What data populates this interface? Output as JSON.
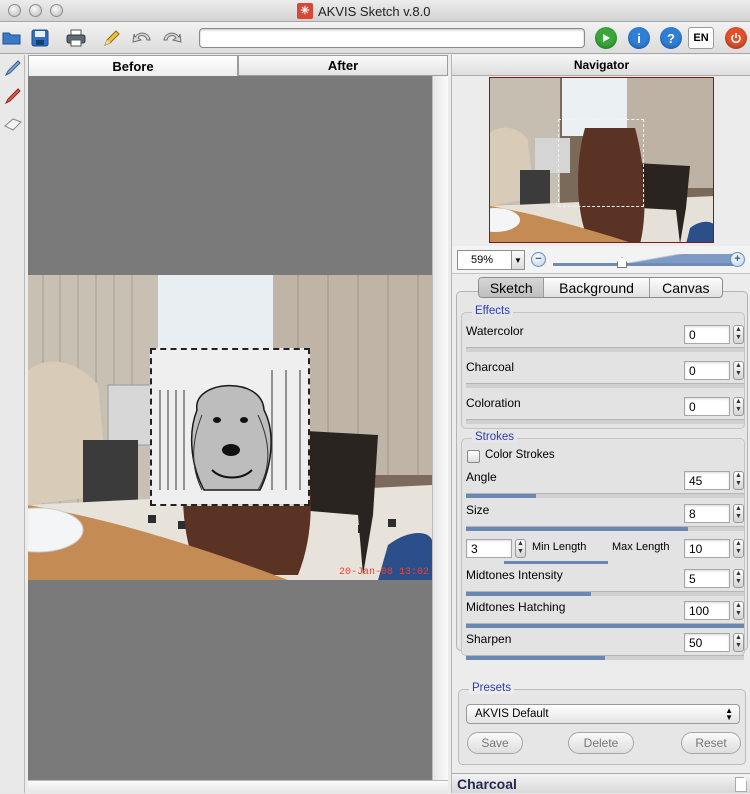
{
  "window": {
    "title": "AKVIS Sketch v.8.0",
    "logo_glyph": "✳"
  },
  "toolbar": {
    "icons": [
      "open-icon",
      "save-icon",
      "print-icon",
      "pencil-icon",
      "undo-icon",
      "redo-icon"
    ],
    "path_value": "",
    "run_color": "#3aa63a",
    "info_color": "#2f7fd8",
    "help_color": "#2f7fd8",
    "lang_label": "EN",
    "power_color": "#e0502a"
  },
  "view_tabs": [
    {
      "label": "Before",
      "active": true
    },
    {
      "label": "After",
      "active": false
    }
  ],
  "canvas": {
    "timestamp": "20-Jan-08  13:02"
  },
  "navigator": {
    "title": "Navigator",
    "zoom_value": "59%",
    "zoom_level_percent": 59
  },
  "settings_tabs": [
    {
      "label": "Sketch",
      "active": true
    },
    {
      "label": "Background",
      "active": false
    },
    {
      "label": "Canvas",
      "active": false
    }
  ],
  "effects": {
    "title": "Effects",
    "params": [
      {
        "label": "Watercolor",
        "value": "0",
        "fill_percent": 0
      },
      {
        "label": "Charcoal",
        "value": "0",
        "fill_percent": 0
      },
      {
        "label": "Coloration",
        "value": "0",
        "fill_percent": 0
      }
    ]
  },
  "strokes": {
    "title": "Strokes",
    "color_strokes_label": "Color Strokes",
    "color_strokes_checked": false,
    "angle": {
      "label": "Angle",
      "value": "45",
      "fill_percent": 25
    },
    "size": {
      "label": "Size",
      "value": "8",
      "fill_percent": 80
    },
    "min_length": {
      "label": "Min Length",
      "value": "3"
    },
    "max_length": {
      "label": "Max Length",
      "value": "10"
    },
    "midtones_intensity": {
      "label": "Midtones Intensity",
      "value": "5",
      "fill_percent": 45
    },
    "midtones_hatching": {
      "label": "Midtones Hatching",
      "value": "100",
      "fill_percent": 100
    },
    "sharpen": {
      "label": "Sharpen",
      "value": "50",
      "fill_percent": 50
    }
  },
  "presets": {
    "title": "Presets",
    "selected": "AKVIS Default",
    "save_label": "Save",
    "delete_label": "Delete",
    "reset_label": "Reset"
  },
  "status": {
    "label": "Charcoal"
  }
}
